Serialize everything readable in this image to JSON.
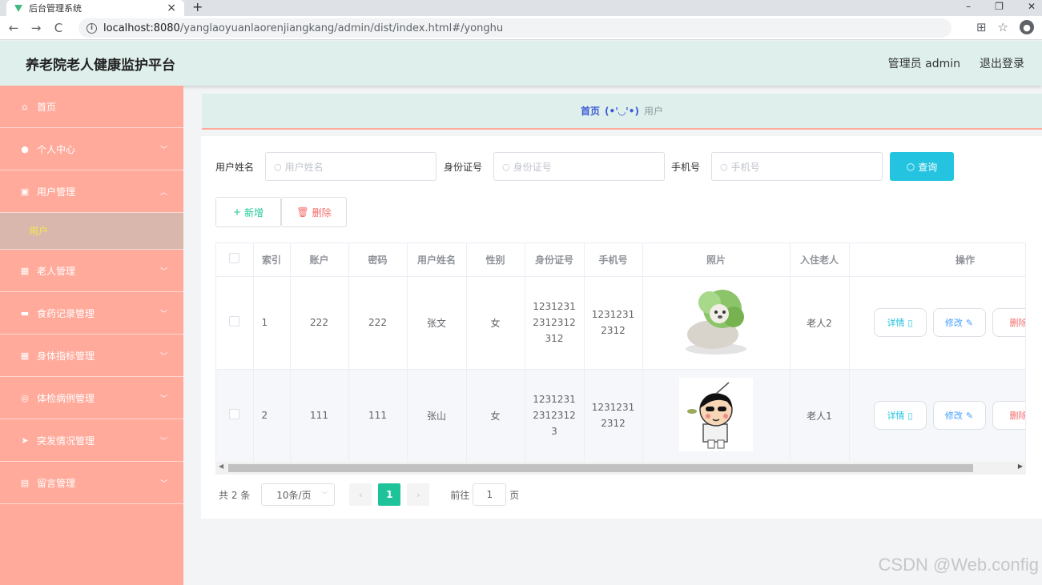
{
  "browser": {
    "tab_title": "后台管理系统",
    "url_host": "localhost:8080",
    "url_path": "/yanglaoyuanlaorenjiangkang/admin/dist/index.html#/yonghu"
  },
  "header": {
    "title": "养老院老人健康监护平台",
    "user": "管理员 admin",
    "logout": "退出登录"
  },
  "sidebar": {
    "items": [
      {
        "label": "首页",
        "icon": "home-icon"
      },
      {
        "label": "个人中心",
        "icon": "person-icon"
      },
      {
        "label": "用户管理",
        "icon": "user-badge-icon"
      },
      {
        "label": "老人管理",
        "icon": "grid-icon"
      },
      {
        "label": "食药记录管理",
        "icon": "briefcase-icon"
      },
      {
        "label": "身体指标管理",
        "icon": "grid-icon"
      },
      {
        "label": "体检病例管理",
        "icon": "globe-icon"
      },
      {
        "label": "突发情况管理",
        "icon": "send-icon"
      },
      {
        "label": "留言管理",
        "icon": "clipboard-icon"
      }
    ],
    "sub_item": "用户"
  },
  "breadcrumb": {
    "home": "首页",
    "separator": "(•'◡'•)",
    "current": "用户"
  },
  "search": {
    "name_label": "用户姓名",
    "name_placeholder": "用户姓名",
    "id_label": "身份证号",
    "id_placeholder": "身份证号",
    "phone_label": "手机号",
    "phone_placeholder": "手机号",
    "query_button": "查询"
  },
  "toolbar": {
    "add_label": "新增",
    "delete_label": "删除"
  },
  "table": {
    "columns": [
      "索引",
      "账户",
      "密码",
      "用户姓名",
      "性别",
      "身份证号",
      "手机号",
      "照片",
      "入住老人",
      "操作"
    ],
    "rows": [
      {
        "index": "1",
        "account": "222",
        "password": "222",
        "name": "张文",
        "gender": "女",
        "id_number": "12312312312312312",
        "phone": "12312312312",
        "photo": "cabbage-dog-photo",
        "elder": "老人2"
      },
      {
        "index": "2",
        "account": "111",
        "password": "111",
        "name": "张山",
        "gender": "女",
        "id_number": "123123123123123",
        "phone": "12312312312",
        "photo": "cartoon-boy-photo",
        "elder": "老人1"
      }
    ],
    "actions": {
      "detail": "详情",
      "edit": "修改",
      "delete": "删除"
    }
  },
  "pagination": {
    "total": "共 2 条",
    "page_size": "10条/页",
    "current_page": "1",
    "goto_prefix": "前往",
    "goto_value": "1",
    "goto_suffix": "页"
  },
  "watermark": "CSDN @Web.config",
  "colors": {
    "header_bg": "#dff0ec",
    "sidebar_bg": "#ffaa9b",
    "query_button": "#24c3e0",
    "active_page": "#1ec39a"
  }
}
